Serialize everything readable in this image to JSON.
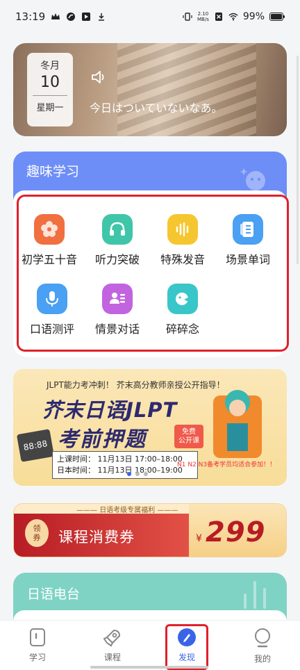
{
  "status_bar": {
    "time": "13:19",
    "speed_top": "2.10",
    "speed_bottom": "MB/s",
    "battery": "99%"
  },
  "hero": {
    "month": "冬月",
    "day": "10",
    "weekday": "星期一",
    "quote": "今日はついていないなあ。"
  },
  "fun": {
    "title": "趣味学习",
    "items": [
      {
        "label": "初学五十音",
        "icon": "flower-icon",
        "color": "#f0703f"
      },
      {
        "label": "听力突破",
        "icon": "headphones-icon",
        "color": "#3fc6a8"
      },
      {
        "label": "特殊发音",
        "icon": "soundwave-icon",
        "color": "#f5c630"
      },
      {
        "label": "场景单词",
        "icon": "book-icon",
        "color": "#4aa0f2"
      },
      {
        "label": "口语测评",
        "icon": "microphone-icon",
        "color": "#4aa0f2"
      },
      {
        "label": "情景对话",
        "icon": "dialogue-icon",
        "color": "#c264e0"
      },
      {
        "label": "碎碎念",
        "icon": "chat-face-icon",
        "color": "#39c6c9"
      }
    ]
  },
  "banner": {
    "subtitle": "JLPT能力考冲刺！ 芥末高分教师亲授公开指导！",
    "headline_1": "芥末日语JLPT",
    "headline_2": "考前押题",
    "badge_1": "免费",
    "badge_2": "公开课",
    "time_1": "上课时间：  11月13日  17:00–18:00",
    "time_2": "日本时间：  11月13日  18:00–19:00",
    "levels": "N1 N2 N3备考学员均适合参加！！",
    "clock_text": "88:88"
  },
  "coupon": {
    "note": "日语考级专属福利",
    "seal_1": "领",
    "seal_2": "券",
    "name": "课程消费券",
    "currency": "¥",
    "price": "299"
  },
  "radio": {
    "title": "日语电台"
  },
  "nav": {
    "items": [
      {
        "label": "学习",
        "icon": "study-icon"
      },
      {
        "label": "课程",
        "icon": "rocket-icon"
      },
      {
        "label": "发现",
        "icon": "discover-icon"
      },
      {
        "label": "我的",
        "icon": "profile-icon"
      }
    ],
    "active": "发现",
    "accent": "#3a64e8"
  }
}
